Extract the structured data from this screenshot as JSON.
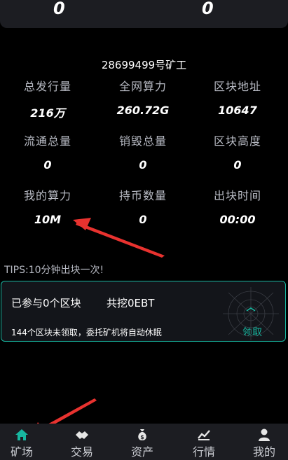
{
  "top": {
    "left_value": "0",
    "right_value": "0"
  },
  "miner_id": "28699499号矿工",
  "stats": [
    {
      "label": "总发行量",
      "value": "216万"
    },
    {
      "label": "全网算力",
      "value": "260.72G"
    },
    {
      "label": "区块地址",
      "value": "10647"
    },
    {
      "label": "流通总量",
      "value": "0"
    },
    {
      "label": "销毁总量",
      "value": "0"
    },
    {
      "label": "区块高度",
      "value": "0"
    },
    {
      "label": "我的算力",
      "value": "10M"
    },
    {
      "label": "持币数量",
      "value": "0"
    },
    {
      "label": "出块时间",
      "value": "00:00"
    }
  ],
  "tips": "TIPS:10分钟出块一次!",
  "card": {
    "joined": "已参与0个区块",
    "mined": "共挖0EBT",
    "note": "144个区块未领取，委托矿机将自动休眠",
    "claim": "领取"
  },
  "tabs": [
    {
      "label": "矿场",
      "icon": "home-icon"
    },
    {
      "label": "交易",
      "icon": "handshake-icon"
    },
    {
      "label": "资产",
      "icon": "money-bag-icon"
    },
    {
      "label": "行情",
      "icon": "trend-chart-icon"
    },
    {
      "label": "我的",
      "icon": "user-icon"
    }
  ],
  "colors": {
    "accent": "#17b7a0",
    "background": "#000000",
    "annotation_arrow": "#e8322f"
  }
}
